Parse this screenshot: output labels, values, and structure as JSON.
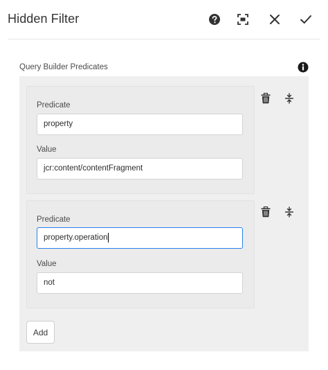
{
  "dialog": {
    "title": "Hidden Filter"
  },
  "header_icons": [
    "help-icon",
    "fullscreen-icon",
    "close-icon",
    "checkmark-icon"
  ],
  "field": {
    "label": "Query Builder Predicates"
  },
  "predicates": [
    {
      "predicate_label": "Predicate",
      "predicate_value": "property",
      "value_label": "Value",
      "value_value": "jcr:content/contentFragment"
    },
    {
      "predicate_label": "Predicate",
      "predicate_value": "property.operation",
      "value_label": "Value",
      "value_value": "not"
    }
  ],
  "add_label": "Add",
  "colors": {
    "focus": "#2680eb",
    "panel": "#efefef",
    "icon": "#323232"
  }
}
